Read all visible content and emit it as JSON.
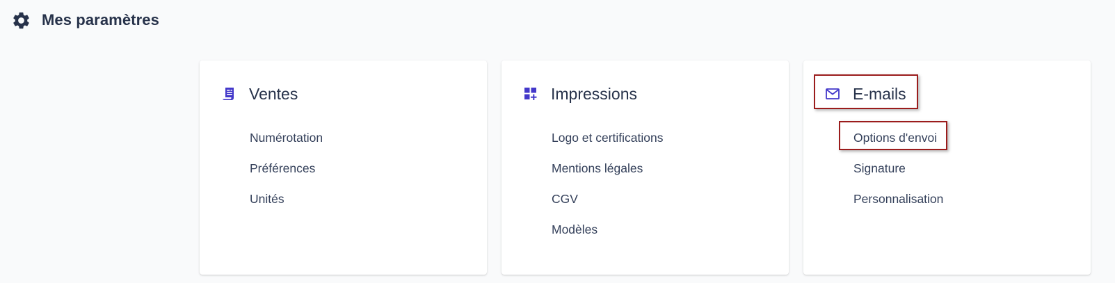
{
  "header": {
    "title": "Mes paramètres",
    "icon": "gear-icon"
  },
  "colors": {
    "accent": "#4338ca",
    "highlight_border": "#9b1c1c",
    "text": "#27324a"
  },
  "cards": [
    {
      "title": "Ventes",
      "icon": "receipt-icon",
      "items": [
        "Numérotation",
        "Préférences",
        "Unités"
      ]
    },
    {
      "title": "Impressions",
      "icon": "dashboard-add-icon",
      "items": [
        "Logo et certifications",
        "Mentions légales",
        "CGV",
        "Modèles"
      ]
    },
    {
      "title": "E-mails",
      "icon": "mail-icon",
      "items": [
        "Options d'envoi",
        "Signature",
        "Personnalisation"
      ]
    }
  ]
}
